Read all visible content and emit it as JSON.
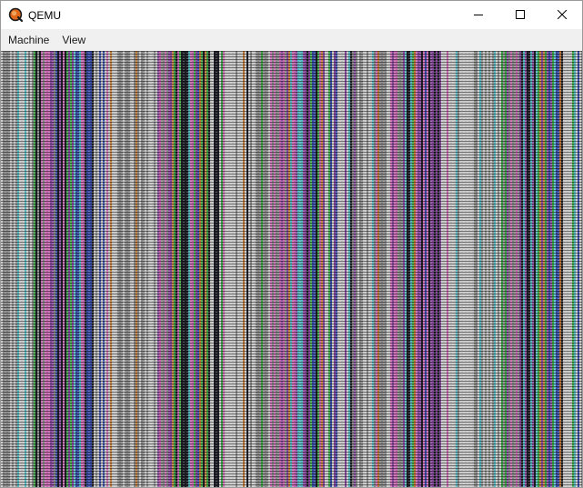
{
  "window": {
    "title": "QEMU",
    "icon": "qemu-logo-icon",
    "controls": {
      "minimize_icon": "minimize-icon",
      "maximize_icon": "maximize-icon",
      "close_icon": "close-icon"
    }
  },
  "menubar": {
    "items": [
      {
        "label": "Machine"
      },
      {
        "label": "View"
      }
    ]
  },
  "display": {
    "content": "garbled-vertical-color-stripes",
    "colors": {
      "gray_light": "#c8c8c8",
      "gray_mid": "#8a8a8a",
      "dark": "#202028",
      "purple": "#8a4c9e",
      "green": "#3fa64a",
      "blue": "#3b4fa8",
      "pink": "#c86ab0",
      "cyan": "#5ab8c0",
      "orange": "#c07a3a"
    }
  }
}
